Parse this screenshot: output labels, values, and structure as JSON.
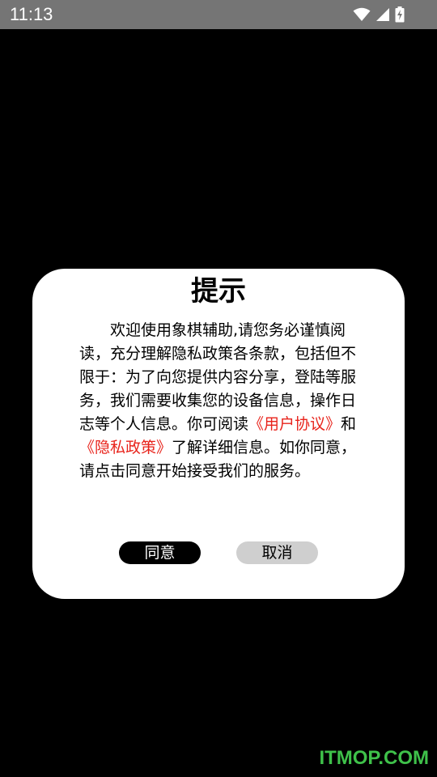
{
  "status_bar": {
    "time": "11:13",
    "icons": [
      "wifi-icon",
      "signal-icon",
      "battery-charging-icon"
    ]
  },
  "dialog": {
    "title": "提示",
    "message": {
      "intro": "欢迎使用象棋辅助,请您务必谨慎阅读，充分理解隐私政策各条款，包括但不限于：为了向您提供内容分享，登陆等服务，我们需要收集您的设备信息，操作日志等个人信息。你可阅读",
      "user_agreement_link": "《用户协议》",
      "conjunction": "和",
      "privacy_policy_link": "《隐私政策》",
      "outro": "了解详细信息。如你同意，请点击同意开始接受我们的服务。"
    },
    "agree_label": "同意",
    "cancel_label": "取消"
  },
  "watermark": "ITMOP.COM",
  "colors": {
    "status_bar": "#757575",
    "background": "#000000",
    "dialog": "#ffffff",
    "link": "#e8231b",
    "agree_button": "#000000",
    "cancel_button": "#cfcfcf",
    "watermark": "#3fc14a"
  }
}
